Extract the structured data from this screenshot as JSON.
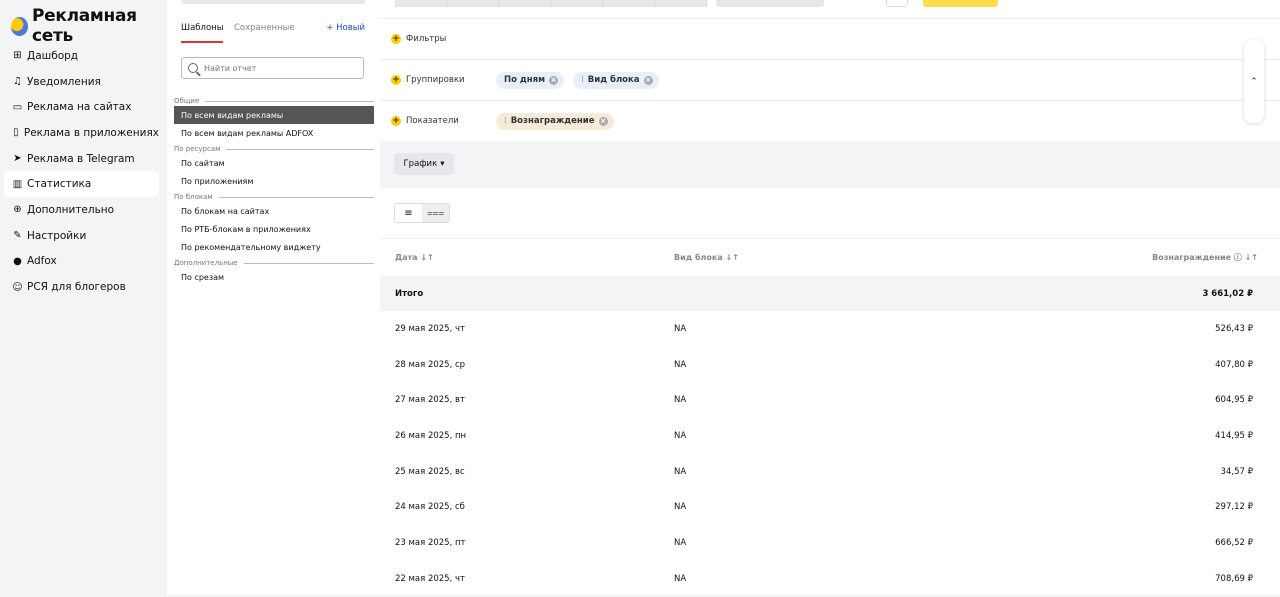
{
  "app": {
    "title": "Рекламная сеть"
  },
  "nav": [
    {
      "icon": "dashboard-icon",
      "glyph": "⊞",
      "label": "Дашборд"
    },
    {
      "icon": "bell-icon",
      "glyph": "♫",
      "label": "Уведомления"
    },
    {
      "icon": "monitor-icon",
      "glyph": "▭",
      "label": "Реклама на сайтах"
    },
    {
      "icon": "phone-icon",
      "glyph": "▯",
      "label": "Реклама в приложениях"
    },
    {
      "icon": "telegram-icon",
      "glyph": "➤",
      "label": "Реклама в Telegram"
    },
    {
      "icon": "chart-icon",
      "glyph": "▥",
      "label": "Статистика"
    },
    {
      "icon": "plus-circle-icon",
      "glyph": "⊕",
      "label": "Дополнительно"
    },
    {
      "icon": "wrench-icon",
      "glyph": "✎",
      "label": "Настройки"
    },
    {
      "icon": "adfox-icon",
      "glyph": "●",
      "label": "Adfox"
    },
    {
      "icon": "smile-icon",
      "glyph": "☺",
      "label": "РСЯ для блогеров"
    }
  ],
  "templates": {
    "tab_templates": "Шаблоны",
    "tab_saved": "Сохраненные",
    "new_button": "+ Новый",
    "search_placeholder": "Найти отчет",
    "group_general": "Общие",
    "item_all": "По всем видам рекламы",
    "item_all_adfox": "По всем видам рекламы ADFOX",
    "group_resources": "По ресурсам",
    "item_sites": "По сайтам",
    "item_apps": "По приложениям",
    "group_blocks": "По блокам",
    "item_blocks_sites": "По блокам на сайтах",
    "item_rtb_apps": "По РТБ-блокам в приложениях",
    "item_widget": "По рекомендательному виджету",
    "group_extra": "Дополнительные",
    "item_slices": "По срезам"
  },
  "filters": {
    "filters_label": "Фильтры",
    "groupings_label": "Группировки",
    "group_chip_1": "По дням",
    "group_chip_2": "Вид блока",
    "metrics_label": "Показатели",
    "metric_chip_1": "Вознаграждение"
  },
  "chart_toggle": {
    "label": "График"
  },
  "table": {
    "col_date": "Дата ↓↑",
    "col_block": "Вид блока ↓↑",
    "col_reward": "Вознаграждение ⓘ ↓↑",
    "total_label": "Итого",
    "total_value": "3 661,02 ₽",
    "rows": [
      {
        "date": "29 мая 2025, чт",
        "block": "NA",
        "reward": "526,43 ₽"
      },
      {
        "date": "28 мая 2025, ср",
        "block": "NA",
        "reward": "407,80 ₽"
      },
      {
        "date": "27 мая 2025, вт",
        "block": "NA",
        "reward": "604,95 ₽"
      },
      {
        "date": "26 мая 2025, пн",
        "block": "NA",
        "reward": "414,95 ₽"
      },
      {
        "date": "25 мая 2025, вс",
        "block": "NA",
        "reward": "34,57 ₽"
      },
      {
        "date": "24 мая 2025, сб",
        "block": "NA",
        "reward": "297,12 ₽"
      },
      {
        "date": "23 мая 2025, пт",
        "block": "NA",
        "reward": "666,52 ₽"
      },
      {
        "date": "22 мая 2025, чт",
        "block": "NA",
        "reward": "708,69 ₽"
      }
    ]
  }
}
